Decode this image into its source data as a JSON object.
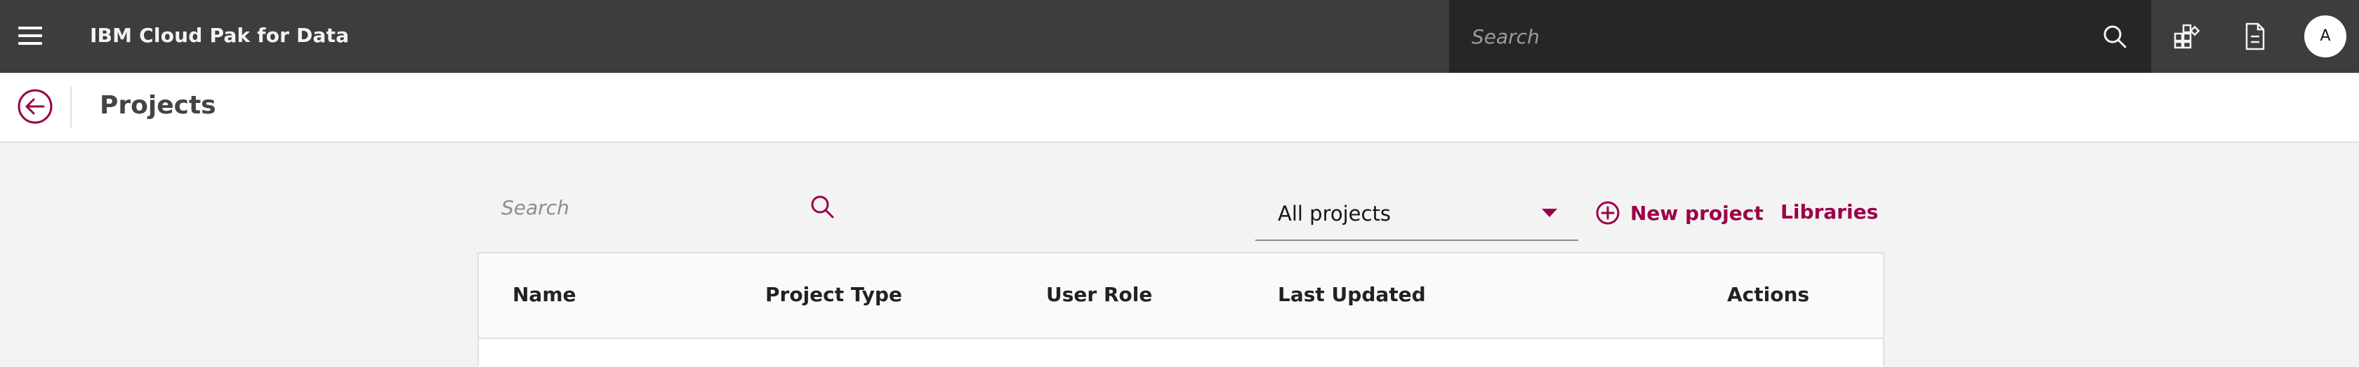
{
  "topbar": {
    "app_title": "IBM Cloud Pak for Data",
    "search_placeholder": "Search",
    "avatar_initial": "A",
    "icons": [
      "hamburger-menu-icon",
      "search-icon",
      "apps-icon",
      "document-icon"
    ]
  },
  "header": {
    "page_title": "Projects",
    "back_icon": "arrow-left-circle-icon"
  },
  "toolbar": {
    "search_placeholder": "Search",
    "filter_value": "All projects",
    "new_project_label": "New project",
    "libraries_label": "Libraries"
  },
  "table": {
    "columns": [
      "Name",
      "Project Type",
      "User Role",
      "Last Updated",
      "Actions"
    ]
  },
  "colors": {
    "topbar_bg": "#3d3d3d",
    "search_bg": "#262626",
    "accent": "#9b0048",
    "page_bg": "#f3f3f3"
  }
}
